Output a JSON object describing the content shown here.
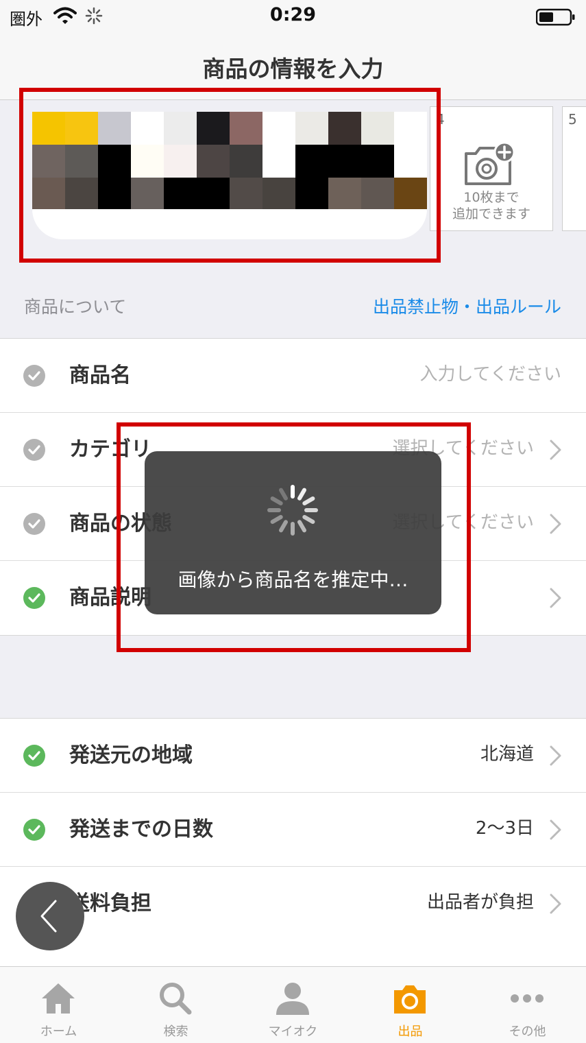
{
  "status_bar": {
    "carrier": "圏外",
    "time": "0:29"
  },
  "nav": {
    "title": "商品の情報を入力"
  },
  "photos": {
    "slot4_number": "4",
    "slot5_number": "5",
    "caption_line1": "10枚まで",
    "caption_line2": "追加できます"
  },
  "section": {
    "title": "商品について",
    "link": "出品禁止物・出品ルール"
  },
  "item_rows": [
    {
      "label": "商品名",
      "value": "入力してください",
      "done": false
    },
    {
      "label": "カテゴリ",
      "value": "選択してください",
      "done": false
    },
    {
      "label": "商品の状態",
      "value": "選択してください",
      "done": false
    },
    {
      "label": "商品説明",
      "value": "",
      "done": true
    }
  ],
  "shipping_rows": [
    {
      "label": "発送元の地域",
      "value": "北海道",
      "done": true
    },
    {
      "label": "発送までの日数",
      "value": "2～3日",
      "done": true
    },
    {
      "label": "送料負担",
      "value": "出品者が負担",
      "done": true
    }
  ],
  "hud": {
    "message": "画像から商品名を推定中…"
  },
  "tabs": [
    {
      "label": "ホーム",
      "icon": "home-icon"
    },
    {
      "label": "検索",
      "icon": "search-icon"
    },
    {
      "label": "マイオク",
      "icon": "person-icon"
    },
    {
      "label": "出品",
      "icon": "camera-icon",
      "active": true
    },
    {
      "label": "その他",
      "icon": "more-icon"
    }
  ],
  "colors": {
    "accent": "#f39800",
    "link": "#1a8be8",
    "check_done": "#5cb85c",
    "check_todo": "#b3b3b3",
    "highlight": "#d10000"
  }
}
